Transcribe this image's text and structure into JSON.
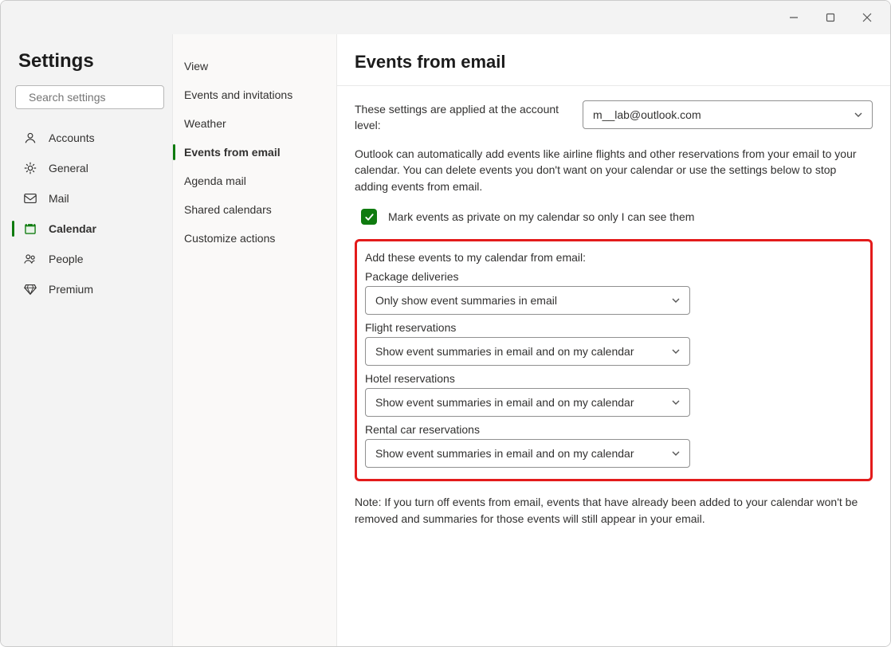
{
  "window": {
    "title": "Settings"
  },
  "search": {
    "placeholder": "Search settings"
  },
  "nav1": [
    {
      "id": "accounts",
      "label": "Accounts",
      "icon": "person"
    },
    {
      "id": "general",
      "label": "General",
      "icon": "gear"
    },
    {
      "id": "mail",
      "label": "Mail",
      "icon": "mail"
    },
    {
      "id": "calendar",
      "label": "Calendar",
      "icon": "calendar",
      "active": true
    },
    {
      "id": "people",
      "label": "People",
      "icon": "people"
    },
    {
      "id": "premium",
      "label": "Premium",
      "icon": "diamond"
    }
  ],
  "nav2": [
    {
      "id": "view",
      "label": "View"
    },
    {
      "id": "invites",
      "label": "Events and invitations"
    },
    {
      "id": "weather",
      "label": "Weather"
    },
    {
      "id": "efe",
      "label": "Events from email",
      "active": true
    },
    {
      "id": "agenda",
      "label": "Agenda mail"
    },
    {
      "id": "shared",
      "label": "Shared calendars"
    },
    {
      "id": "custom",
      "label": "Customize actions"
    }
  ],
  "page": {
    "heading": "Events from email",
    "account_label": "These settings are applied at the account level:",
    "account_value": "m__lab@outlook.com",
    "description": "Outlook can automatically add events like airline flights and other reservations from your email to your calendar. You can delete events you don't want on your calendar or use the settings below to stop adding events from email.",
    "checkbox_label": "Mark events as private on my calendar so only I can see them",
    "checkbox_checked": true,
    "section_title": "Add these events to my calendar from email:",
    "fields": [
      {
        "label": "Package deliveries",
        "value": "Only show event summaries in email"
      },
      {
        "label": "Flight reservations",
        "value": "Show event summaries in email and on my calendar"
      },
      {
        "label": "Hotel reservations",
        "value": "Show event summaries in email and on my calendar"
      },
      {
        "label": "Rental car reservations",
        "value": "Show event summaries in email and on my calendar"
      }
    ],
    "note": "Note: If you turn off events from email, events that have already been added to your calendar won't be removed and summaries for those events will still appear in your email."
  }
}
